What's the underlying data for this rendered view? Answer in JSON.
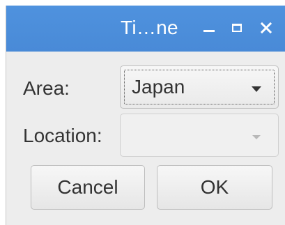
{
  "window": {
    "title": "Ti…ne",
    "controls": {
      "minimize_icon": "minimize-icon",
      "maximize_icon": "maximize-icon",
      "close_icon": "close-icon"
    },
    "titlebar_color": "#4c8edb"
  },
  "form": {
    "area_label": "Area:",
    "area_value": "Japan",
    "location_label": "Location:",
    "location_value": ""
  },
  "buttons": {
    "cancel_label": "Cancel",
    "ok_label": "OK"
  }
}
